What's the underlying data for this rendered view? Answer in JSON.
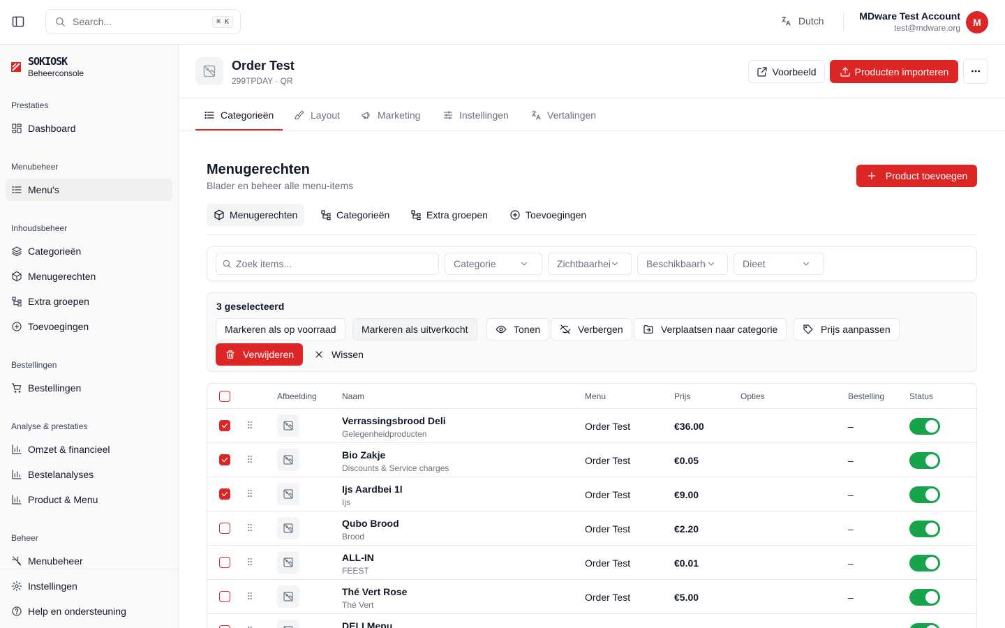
{
  "topbar": {
    "search_placeholder": "Search...",
    "search_shortcut": "⌘ K",
    "language": "Dutch",
    "account_name": "MDware Test Account",
    "account_email": "test@mdware.org",
    "avatar_initial": "M"
  },
  "sidebar": {
    "brand_logo": "SOKIOSK",
    "brand_sub": "Beheerconsole",
    "sections": {
      "prestaties": "Prestaties",
      "menubeheer": "Menubeheer",
      "inhoudsbeheer": "Inhoudsbeheer",
      "bestellingen": "Bestellingen",
      "analyse": "Analyse & prestaties",
      "beheer": "Beheer"
    },
    "items": {
      "dashboard": "Dashboard",
      "menus": "Menu's",
      "categorieen": "Categorieën",
      "menugerechten": "Menugerechten",
      "extra_groepen": "Extra groepen",
      "toevoegingen": "Toevoegingen",
      "bestellingen": "Bestellingen",
      "omzet": "Omzet & financieel",
      "bestelanalyses": "Bestelanalyses",
      "product_menu": "Product & Menu",
      "menubeheer": "Menubeheer",
      "instellingen": "Instellingen",
      "help": "Help en ondersteuning"
    }
  },
  "header": {
    "title": "Order Test",
    "subtitle": "299TPDAY · QR",
    "preview_label": "Voorbeeld",
    "import_label": "Producten importeren"
  },
  "tabs": {
    "categorieen": "Categorieën",
    "layout": "Layout",
    "marketing": "Marketing",
    "instellingen": "Instellingen",
    "vertalingen": "Vertalingen"
  },
  "section": {
    "title": "Menugerechten",
    "subtitle": "Blader en beheer alle menu-items",
    "add_label": "Product toevoegen"
  },
  "subtabs": {
    "menugerechten": "Menugerechten",
    "categorieen": "Categorieën",
    "extra_groepen": "Extra groepen",
    "toevoegingen": "Toevoegingen"
  },
  "filters": {
    "search_placeholder": "Zoek items...",
    "categorie": "Categorie",
    "zichtbaarheid": "Zichtbaarheid",
    "beschikbaarheid": "Beschikbaarheid",
    "dieet": "Dieet"
  },
  "bulk": {
    "selected": "3 geselecteerd",
    "mark_stock": "Markeren als op voorraad",
    "mark_soldout": "Markeren als uitverkocht",
    "show": "Tonen",
    "hide": "Verbergen",
    "move": "Verplaatsen naar categorie",
    "price": "Prijs aanpassen",
    "delete": "Verwijderen",
    "clear": "Wissen"
  },
  "table": {
    "headers": {
      "afbeelding": "Afbeelding",
      "naam": "Naam",
      "menu": "Menu",
      "prijs": "Prijs",
      "opties": "Opties",
      "bestelling": "Bestelling",
      "status": "Status"
    },
    "rows": [
      {
        "name": "Verrassingsbrood Deli",
        "category": "Gelegenheidproducten",
        "menu": "Order Test",
        "price": "€36.00",
        "order": "–",
        "checked": true
      },
      {
        "name": "Bio Zakje",
        "category": "Discounts & Service charges",
        "menu": "Order Test",
        "price": "€0.05",
        "order": "–",
        "checked": true
      },
      {
        "name": "Ijs Aardbei 1l",
        "category": "Ijs",
        "menu": "Order Test",
        "price": "€9.00",
        "order": "–",
        "checked": true
      },
      {
        "name": "Qubo Brood",
        "category": "Brood",
        "menu": "Order Test",
        "price": "€2.20",
        "order": "–",
        "checked": false
      },
      {
        "name": "ALL-IN",
        "category": "FEEST",
        "menu": "Order Test",
        "price": "€0.01",
        "order": "–",
        "checked": false
      },
      {
        "name": "Thé Vert Rose",
        "category": "Thé Vert",
        "menu": "Order Test",
        "price": "€5.00",
        "order": "–",
        "checked": false
      },
      {
        "name": "DELI Menu",
        "category": "",
        "menu": "",
        "price": "",
        "order": "",
        "checked": false
      }
    ]
  },
  "colors": {
    "accent": "#dc2626",
    "toggle_on": "#16a34a"
  }
}
